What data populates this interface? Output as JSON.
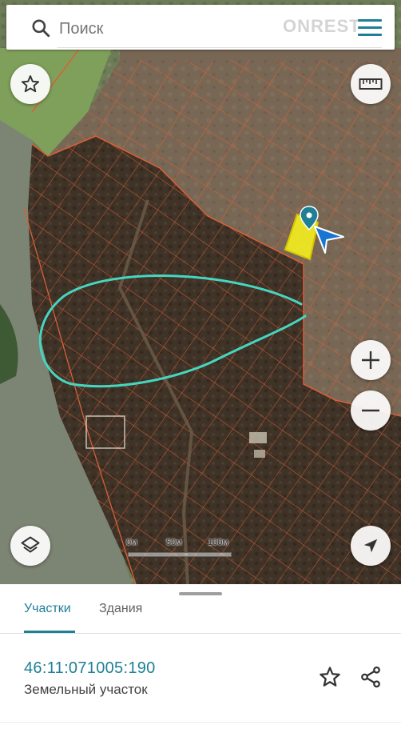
{
  "search": {
    "placeholder": "Поиск",
    "watermark": "ONREST"
  },
  "map": {
    "scale_labels": [
      "0м",
      "50м",
      "100м"
    ],
    "colors": {
      "parcel_lines": "#e0673a",
      "selected_parcel": "#f5ee1f",
      "route": "#45d6c0",
      "accent": "#1e7f95"
    }
  },
  "icons": {
    "search": "search-icon",
    "menu": "hamburger-menu-icon",
    "favorite": "star-outline-icon",
    "ruler": "ruler-icon",
    "zoom_in": "plus-icon",
    "zoom_out": "minus-icon",
    "layers": "layers-icon",
    "locate": "navigation-arrow-icon",
    "pin": "map-pin-icon",
    "share": "share-icon"
  },
  "tabs": [
    {
      "label": "Участки",
      "active": true
    },
    {
      "label": "Здания",
      "active": false
    }
  ],
  "parcel": {
    "cadastral_number": "46:11:071005:190",
    "type": "Земельный участок"
  }
}
